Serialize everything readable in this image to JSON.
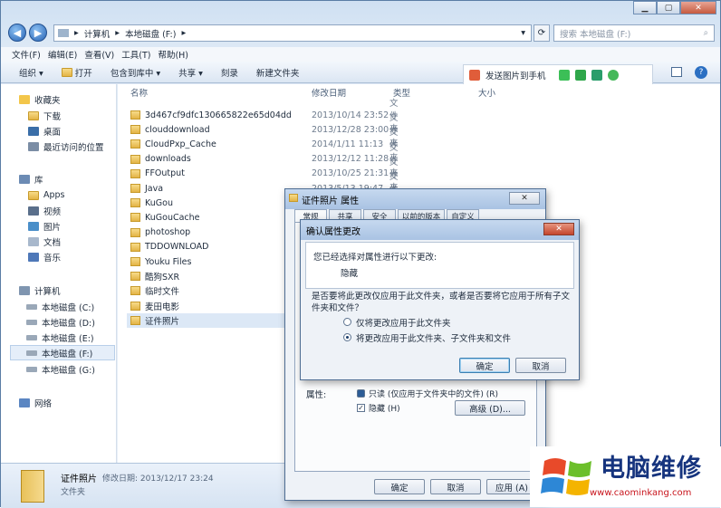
{
  "address": {
    "crumbs": [
      "计算机",
      "本地磁盘 (F:)"
    ]
  },
  "search": {
    "placeholder": "搜索 本地磁盘 (F:)"
  },
  "menu": [
    "文件(F)",
    "编辑(E)",
    "查看(V)",
    "工具(T)",
    "帮助(H)"
  ],
  "toolbar": {
    "organize": "组织 ▾",
    "open": "打开",
    "include": "包含到库中 ▾",
    "share": "共享 ▾",
    "burn": "刻录",
    "new_folder": "新建文件夹"
  },
  "plugin": {
    "send_label": "发送图片到手机"
  },
  "sidebar": {
    "favorites": "收藏夹",
    "fav_items": [
      "下载",
      "桌面",
      "最近访问的位置"
    ],
    "libraries": "库",
    "lib_items": [
      "Apps",
      "视频",
      "图片",
      "文档",
      "音乐"
    ],
    "computer": "计算机",
    "drives": [
      "本地磁盘 (C:)",
      "本地磁盘 (D:)",
      "本地磁盘 (E:)",
      "本地磁盘 (F:)",
      "本地磁盘 (G:)"
    ],
    "network": "网络"
  },
  "columns": {
    "name": "名称",
    "date": "修改日期",
    "type": "类型",
    "size": "大小"
  },
  "files": [
    {
      "name": "3d467cf9dfc130665822e65d04dd",
      "date": "2013/10/14 23:52",
      "type": "文件夹"
    },
    {
      "name": "clouddownload",
      "date": "2013/12/28 23:00",
      "type": "文件夹"
    },
    {
      "name": "CloudPxp_Cache",
      "date": "2014/1/11 11:13",
      "type": "文件夹"
    },
    {
      "name": "downloads",
      "date": "2013/12/12 11:28",
      "type": "文件夹"
    },
    {
      "name": "FFOutput",
      "date": "2013/10/25 21:31",
      "type": "文件夹"
    },
    {
      "name": "Java",
      "date": "2013/5/13 19:47",
      "type": "文件夹"
    },
    {
      "name": "KuGou",
      "date": "",
      "type": ""
    },
    {
      "name": "KuGouCache",
      "date": "",
      "type": ""
    },
    {
      "name": "photoshop",
      "date": "",
      "type": ""
    },
    {
      "name": "TDDOWNLOAD",
      "date": "",
      "type": ""
    },
    {
      "name": "Youku Files",
      "date": "",
      "type": ""
    },
    {
      "name": "酷狗SXR",
      "date": "",
      "type": ""
    },
    {
      "name": "临时文件",
      "date": "",
      "type": ""
    },
    {
      "name": "麦田电影",
      "date": "",
      "type": ""
    },
    {
      "name": "证件照片",
      "date": "",
      "type": ""
    }
  ],
  "details": {
    "name": "证件照片",
    "modified": "修改日期: 2013/12/17 23:24",
    "type": "文件夹"
  },
  "props": {
    "title": "证件照片 属性",
    "tabs": [
      "常规",
      "共享",
      "安全",
      "以前的版本",
      "自定义"
    ],
    "attr_label": "属性:",
    "readonly": "只读 (仅应用于文件夹中的文件) (R)",
    "hidden": "隐藏 (H)",
    "advanced": "高级 (D)...",
    "ok": "确定",
    "cancel": "取消",
    "apply": "应用 (A)"
  },
  "confirm": {
    "title": "确认属性更改",
    "line1": "您已经选择对属性进行以下更改:",
    "change": "隐藏",
    "question": "是否要将此更改仅应用于此文件夹，或者是否要将它应用于所有子文件夹和文件？",
    "opt1": "仅将更改应用于此文件夹",
    "opt2": "将更改应用于此文件夹、子文件夹和文件",
    "ok": "确定",
    "cancel": "取消"
  },
  "watermark": {
    "brand": "电脑维修",
    "url": "www.caominkang.com"
  }
}
